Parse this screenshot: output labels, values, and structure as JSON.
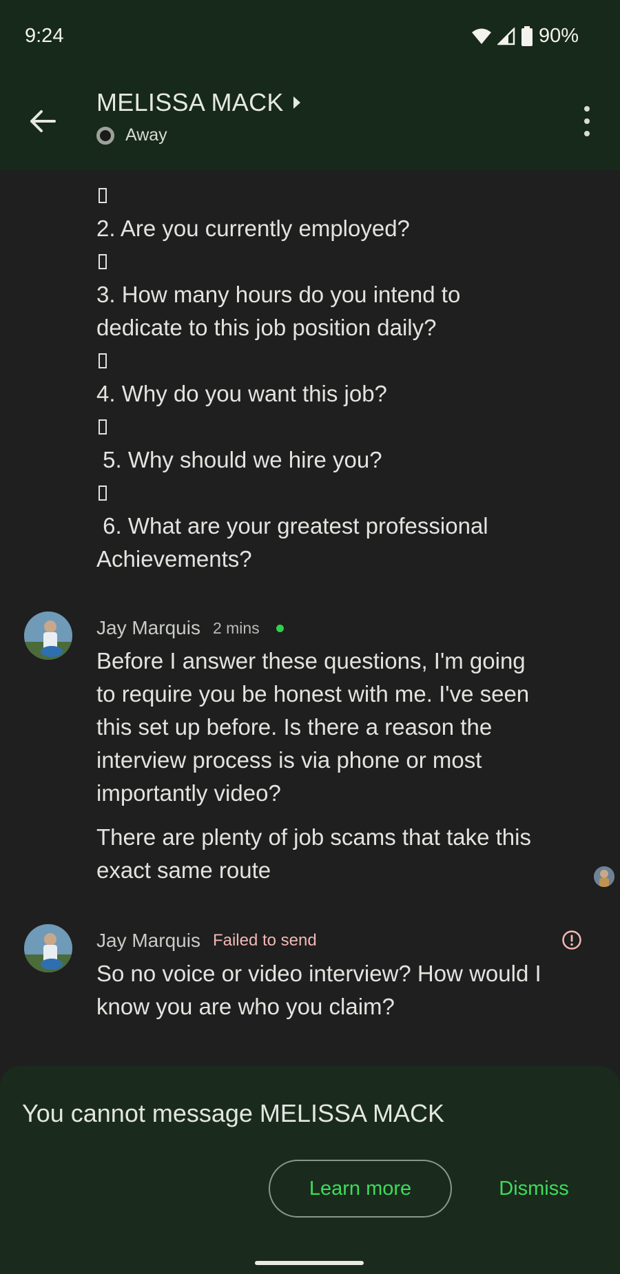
{
  "status_bar": {
    "time": "9:24",
    "battery": "90%"
  },
  "header": {
    "title": "MELISSA MACK",
    "presence": "Away"
  },
  "previous_message_lines": [
    "2. Are you currently employed?",
    "3. How many hours do you intend to",
    "dedicate to this job position daily?",
    "4. Why do you want this job?",
    " 5. Why should we hire you?",
    " 6. What are your greatest professional",
    "Achievements?"
  ],
  "message1": {
    "sender": "Jay Marquis",
    "time": "2 mins",
    "para1_lines": [
      "Before I answer these questions, I'm going",
      "to require you be honest with me. I've seen",
      "this set up before. Is there a reason the",
      "interview process is via phone or most",
      "importantly video?"
    ],
    "para2_lines": [
      "There are plenty of job scams that take this",
      "exact same route"
    ]
  },
  "message2": {
    "sender": "Jay Marquis",
    "status": "Failed to send",
    "lines": [
      "So no voice or video interview? How would I",
      "know you are who you claim?"
    ]
  },
  "sheet": {
    "text": "You cannot message MELISSA MACK",
    "learn_more": "Learn more",
    "dismiss": "Dismiss"
  },
  "colors": {
    "accent": "#3ddc5a",
    "app_bar": "#17291a",
    "background": "#1e1f1e",
    "error": "#f2b8b5"
  }
}
